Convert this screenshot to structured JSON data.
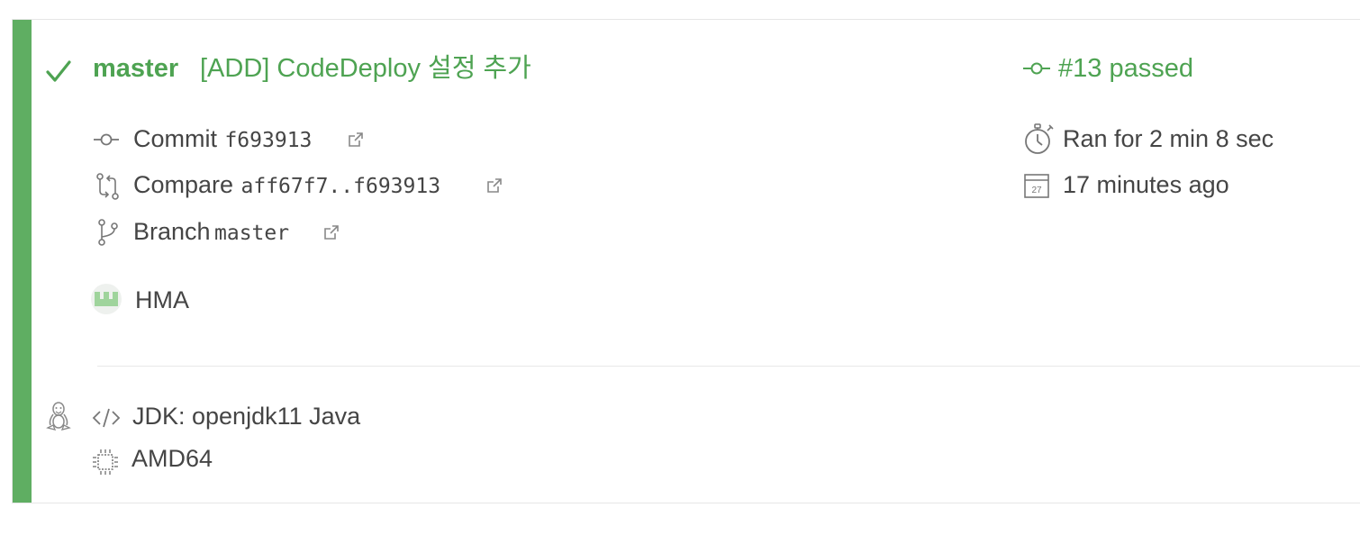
{
  "build": {
    "branch": "master",
    "commit_message": "[ADD] CodeDeploy 설정 추가",
    "build_number_status": "#13 passed",
    "status_color": "#5fae62",
    "status_icon": "check-icon"
  },
  "details": {
    "commit_label": "Commit",
    "commit_sha": "f693913",
    "compare_label": "Compare",
    "compare_range": "aff67f7..f693913",
    "branch_label": "Branch",
    "branch_value": "master",
    "author": "HMA"
  },
  "timing": {
    "duration": "Ran for 2 min 8 sec",
    "finished": "17 minutes ago",
    "calendar_day": "27"
  },
  "job": {
    "language": "JDK: openjdk11 Java",
    "arch": "AMD64",
    "os_icon": "linux-icon"
  }
}
